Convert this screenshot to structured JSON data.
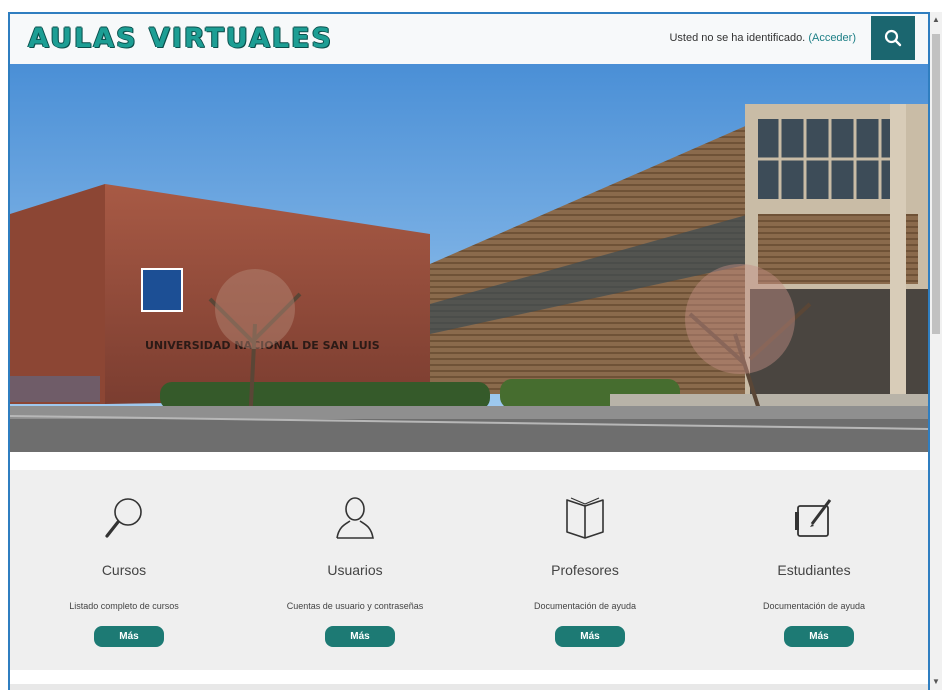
{
  "header": {
    "brand": "AULAS VIRTUALES",
    "login_text": "Usted no se ha identificado.",
    "login_link": "(Acceder)",
    "search_icon": "search-icon"
  },
  "hero": {
    "sign_text": "UNIVERSIDAD NACIONAL DE SAN LUIS"
  },
  "features": [
    {
      "icon": "magnifier-icon",
      "title": "Cursos",
      "description": "Listado completo de cursos",
      "button": "Más"
    },
    {
      "icon": "user-icon",
      "title": "Usuarios",
      "description": "Cuentas de usuario y contraseñas",
      "button": "Más"
    },
    {
      "icon": "book-icon",
      "title": "Profesores",
      "description": "Documentación de ayuda",
      "button": "Más"
    },
    {
      "icon": "tablet-pen-icon",
      "title": "Estudiantes",
      "description": "Documentación de ayuda",
      "button": "Más"
    }
  ],
  "colors": {
    "accent": "#1d7a74",
    "header_button": "#1b666f",
    "brand": "#1d9e94"
  }
}
